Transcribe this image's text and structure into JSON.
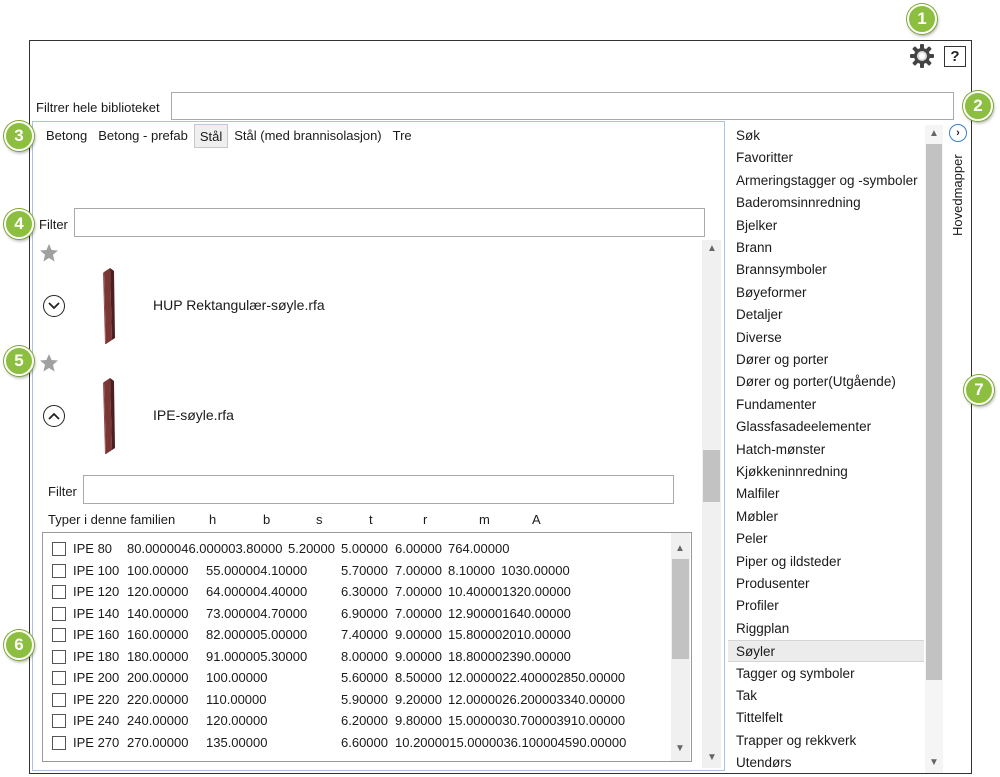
{
  "badges": [
    "1",
    "2",
    "3",
    "4",
    "5",
    "6",
    "7"
  ],
  "toolbar": {
    "help_label": "?"
  },
  "library_filter": {
    "label": "Filtrer hele biblioteket",
    "value": ""
  },
  "tabs": [
    {
      "label": "Betong"
    },
    {
      "label": "Betong - prefab"
    },
    {
      "label": "Stål",
      "active": true
    },
    {
      "label": "Stål (med brannisolasjon)"
    },
    {
      "label": "Tre"
    }
  ],
  "family_filter": {
    "label": "Filter",
    "value": ""
  },
  "families": [
    {
      "name": "HUP Rektangulær-søyle.rfa",
      "expanded": false
    },
    {
      "name": "IPE-søyle.rfa",
      "expanded": true
    }
  ],
  "type_filter": {
    "label": "Filter",
    "value": ""
  },
  "types_header": [
    "Typer i denne familien",
    "h",
    "b",
    "s",
    "t",
    "r",
    "m",
    "A"
  ],
  "types": [
    {
      "name": "IPE 80",
      "c1": "80.0000046.000003.80000",
      "c2": "5.20000",
      "c3": "5.00000",
      "c4": "6.00000",
      "c5": "764.00000"
    },
    {
      "name": "IPE 100",
      "c1": "100.00000",
      "c2": "55.000004.10000",
      "c3": "5.70000",
      "c4": "7.00000",
      "c5": "8.10000",
      "c6": "1030.00000"
    },
    {
      "name": "IPE 120",
      "c1": "120.00000",
      "c2": "64.000004.40000",
      "c3": "6.30000",
      "c4": "7.00000",
      "c5": "10.400001320.00000"
    },
    {
      "name": "IPE 140",
      "c1": "140.00000",
      "c2": "73.000004.70000",
      "c3": "6.90000",
      "c4": "7.00000",
      "c5": "12.900001640.00000"
    },
    {
      "name": "IPE 160",
      "c1": "160.00000",
      "c2": "82.000005.00000",
      "c3": "7.40000",
      "c4": "9.00000",
      "c5": "15.800002010.00000"
    },
    {
      "name": "IPE 180",
      "c1": "180.00000",
      "c2": "91.000005.30000",
      "c3": "8.00000",
      "c4": "9.00000",
      "c5": "18.800002390.00000"
    },
    {
      "name": "IPE 200",
      "c1": "200.00000",
      "c2": "100.00000",
      "c3": "5.60000",
      "c4": "8.50000",
      "c5": "12.0000022.400002850.00000"
    },
    {
      "name": "IPE 220",
      "c1": "220.00000",
      "c2": "110.00000",
      "c3": "5.90000",
      "c4": "9.20000",
      "c5": "12.0000026.200003340.00000"
    },
    {
      "name": "IPE 240",
      "c1": "240.00000",
      "c2": "120.00000",
      "c3": "6.20000",
      "c4": "9.80000",
      "c5": "15.0000030.700003910.00000"
    },
    {
      "name": "IPE 270",
      "c1": "270.00000",
      "c2": "135.00000",
      "c3": "6.60000",
      "c4": "10.2000015.0000036.100004590.00000"
    }
  ],
  "categories": [
    "Søk",
    "Favoritter",
    "Armeringstagger og -symboler",
    "Baderomsinnredning",
    "Bjelker",
    "Brann",
    "Brannsymboler",
    "Bøyeformer",
    "Detaljer",
    "Diverse",
    "Dører og porter",
    "Dører og porter(Utgående)",
    "Fundamenter",
    "Glassfasadeelementer",
    "Hatch-mønster",
    "Kjøkkeninnredning",
    "Malfiler",
    "Møbler",
    "Peler",
    "Piper og ildsteder",
    "Produsenter",
    "Profiler",
    "Riggplan",
    "Søyler",
    "Tagger og symboler",
    "Tak",
    "Tittelfelt",
    "Trapper og rekkverk",
    "Utendørs"
  ],
  "selected_category": "Søyler",
  "side_panel": {
    "label": "Hovedmapper"
  },
  "colors": {
    "badge": "#8cbe3f",
    "column_fill": "#6b2f2f",
    "accent_blue": "#3a7fd0"
  }
}
